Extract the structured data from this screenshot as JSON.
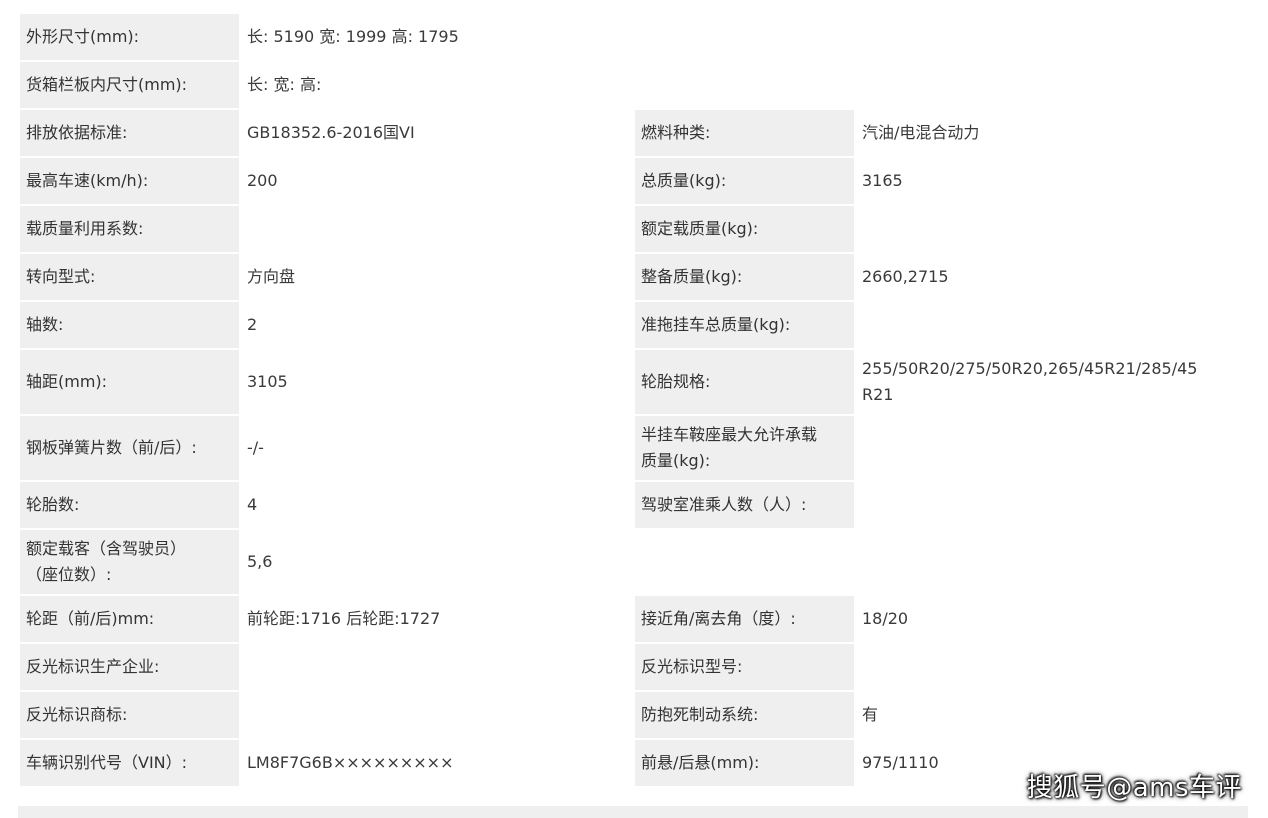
{
  "specs": {
    "dimensions": {
      "label": "外形尺寸(mm):",
      "value": "长: 5190 宽: 1999 高: 1795"
    },
    "cargo_box": {
      "label": "货箱栏板内尺寸(mm):",
      "value": "长:  宽:  高:"
    },
    "rows": [
      {
        "l1": "排放依据标准:",
        "v1": "GB18352.6-2016国VI",
        "l2": "燃料种类:",
        "v2": "汽油/电混合动力"
      },
      {
        "l1": "最高车速(km/h):",
        "v1": "200",
        "l2": "总质量(kg):",
        "v2": "3165"
      },
      {
        "l1": "载质量利用系数:",
        "v1": "",
        "l2": "额定载质量(kg):",
        "v2": ""
      },
      {
        "l1": "转向型式:",
        "v1": "方向盘",
        "l2": "整备质量(kg):",
        "v2": "2660,2715"
      },
      {
        "l1": "轴数:",
        "v1": "2",
        "l2": "准拖挂车总质量(kg):",
        "v2": ""
      },
      {
        "l1": "轴距(mm):",
        "v1": "3105",
        "l2": "轮胎规格:",
        "v2_line1": "255/50R20/275/50R20,265/45R21/285/45",
        "v2_line2": "R21"
      },
      {
        "l1": "钢板弹簧片数（前/后）:",
        "v1": "-/-",
        "l2_line1": "半挂车鞍座最大允许承载",
        "l2_line2": "质量(kg):",
        "v2": ""
      },
      {
        "l1": "轮胎数:",
        "v1": "4",
        "l2": "驾驶室准乘人数（人）:",
        "v2": ""
      }
    ],
    "passengers": {
      "label_line1": "额定载客（含驾驶员）",
      "label_line2": "（座位数）:",
      "value": "5,6"
    },
    "rows2": [
      {
        "l1": "轮距（前/后)mm:",
        "v1": "前轮距:1716 后轮距:1727",
        "l2": "接近角/离去角（度）:",
        "v2": "18/20"
      },
      {
        "l1": "反光标识生产企业:",
        "v1": "",
        "l2": "反光标识型号:",
        "v2": ""
      },
      {
        "l1": "反光标识商标:",
        "v1": "",
        "l2": "防抱死制动系统:",
        "v2": "有"
      },
      {
        "l1": "车辆识别代号（VIN）:",
        "v1": "LM8F7G6B×××××××××",
        "l2": "前悬/后悬(mm):",
        "v2": "975/1110"
      }
    ]
  },
  "watermark": "搜狐号@ams车评",
  "colors": {
    "label_bg": "#efefef",
    "value_bg": "#ffffff",
    "text": "#333333"
  }
}
